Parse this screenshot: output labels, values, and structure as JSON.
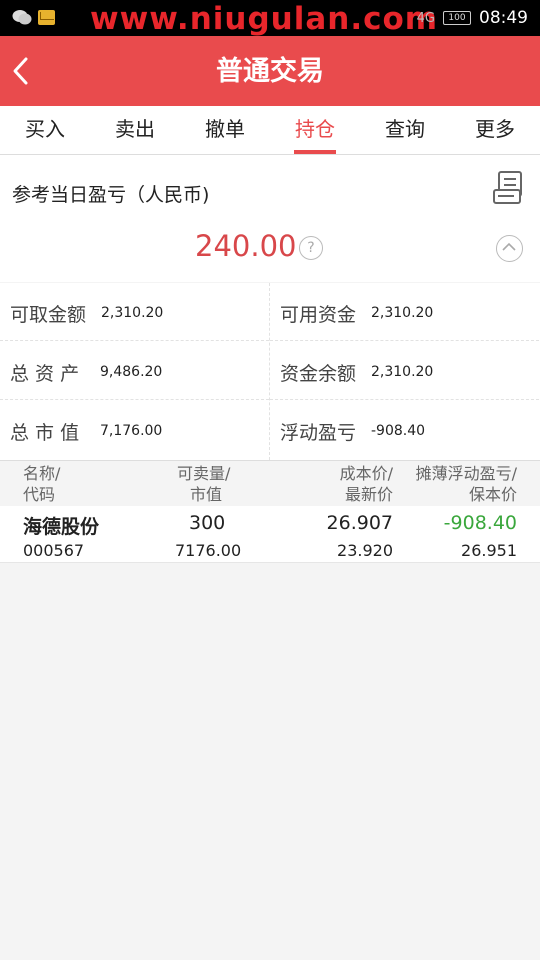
{
  "status_bar": {
    "watermark": "www.niugulan.com",
    "time": "08:49",
    "battery": "100",
    "signal": "4G"
  },
  "header": {
    "title": "普通交易"
  },
  "tabs": [
    {
      "label": "买入"
    },
    {
      "label": "卖出"
    },
    {
      "label": "撤单"
    },
    {
      "label": "持仓",
      "active": true
    },
    {
      "label": "查询"
    },
    {
      "label": "更多"
    }
  ],
  "summary": {
    "label": "参考当日盈亏（人民币)",
    "value": "240.00",
    "help": "?"
  },
  "account": {
    "withdrawable_label": "可取金额",
    "withdrawable": "2,310.20",
    "available_label": "可用资金",
    "available": "2,310.20",
    "total_assets_label": "总 资 产",
    "total_assets": "9,486.20",
    "balance_label": "资金余额",
    "balance": "2,310.20",
    "market_value_label": "总 市 值",
    "market_value": "7,176.00",
    "floating_pnl_label": "浮动盈亏",
    "floating_pnl": "-908.40"
  },
  "holdings": {
    "headers": {
      "name": "名称/",
      "code": "代码",
      "sellable": "可卖量/",
      "mkt_value": "市值",
      "cost": "成本价/",
      "latest": "最新价",
      "float_pnl": "摊薄浮动盈亏/",
      "breakeven": "保本价"
    },
    "rows": [
      {
        "name": "海德股份",
        "code": "000567",
        "sellable": "300",
        "mkt_value": "7176.00",
        "cost": "26.907",
        "latest": "23.920",
        "float_pnl": "-908.40",
        "breakeven": "26.951"
      }
    ]
  },
  "colors": {
    "brand_red": "#e94b4d",
    "profit_red": "#d8474a",
    "loss_green": "#3aa73c"
  }
}
